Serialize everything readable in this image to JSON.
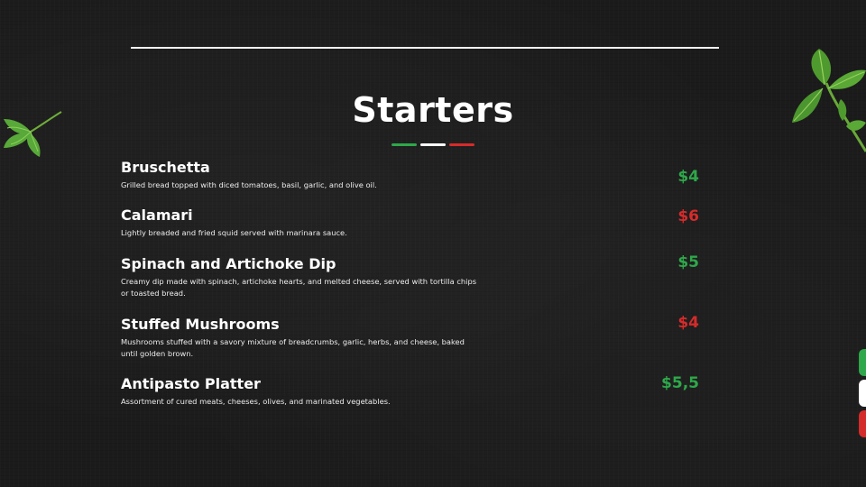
{
  "menu": {
    "title": "Starters",
    "items": [
      {
        "name": "Bruschetta",
        "description": "Grilled bread topped with diced tomatoes, basil, garlic, and olive oil.",
        "price": "$4",
        "price_color": "#2ea84a"
      },
      {
        "name": "Calamari",
        "description": "Lightly breaded and fried squid served with marinara sauce.",
        "price": "$6",
        "price_color": "#d62b2b"
      },
      {
        "name": "Spinach and Artichoke Dip",
        "description": "Creamy dip made with spinach, artichoke hearts, and melted cheese, served with tortilla chips or toasted bread.",
        "price": "$5",
        "price_color": "#2ea84a"
      },
      {
        "name": "Stuffed Mushrooms",
        "description": "Mushrooms stuffed with a savory mixture of breadcrumbs, garlic, herbs, and cheese, baked until golden brown.",
        "price": "$4",
        "price_color": "#d62b2b"
      },
      {
        "name": "Antipasto Platter",
        "description": "Assortment of cured meats, cheeses, olives, and marinated vegetables.",
        "price": "$5,5",
        "price_color": "#2ea84a"
      }
    ]
  },
  "colors": {
    "background": "#1b1b1b",
    "italian_green": "#2ea84a",
    "italian_white": "#ffffff",
    "italian_red": "#d62b2b"
  },
  "decor": {
    "left_leaf_icon": "parsley-leaf-icon",
    "right_leaf_icon": "basil-sprig-icon"
  }
}
